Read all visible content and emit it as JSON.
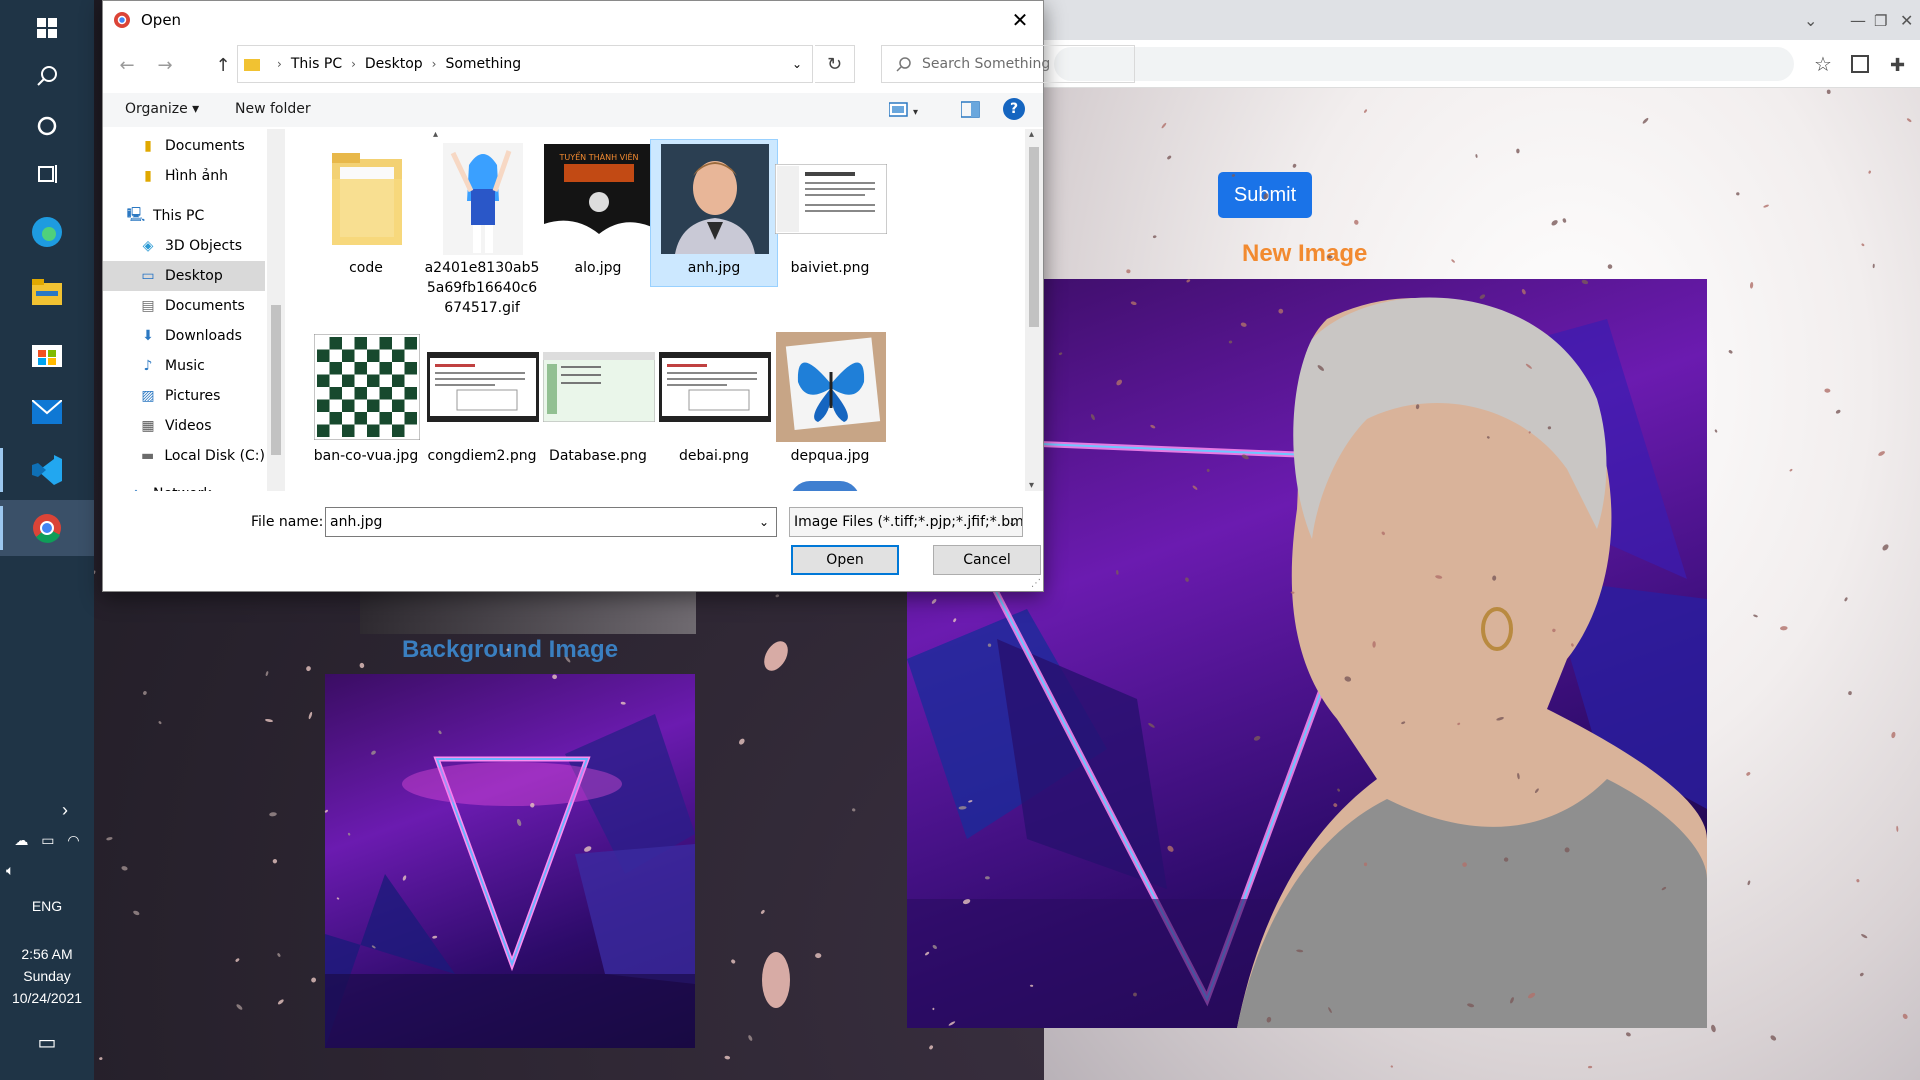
{
  "dialog": {
    "title": "Open",
    "close_glyph": "✕",
    "nav": {
      "back_glyph": "←",
      "forward_glyph": "→",
      "up_glyph": "↑"
    },
    "breadcrumb": [
      "This PC",
      "Desktop",
      "Something"
    ],
    "refresh_glyph": "↻",
    "search_placeholder": "Search Something",
    "toolbar": {
      "organize": "Organize ▾",
      "new_folder": "New folder",
      "help_glyph": "?"
    },
    "nav_pane": [
      {
        "label": "Documents",
        "icon": "folder-icon",
        "glyph": "▮"
      },
      {
        "label": "Hình ảnh",
        "icon": "folder-icon",
        "glyph": "▮"
      },
      {
        "label": "This PC",
        "icon": "pc-icon",
        "glyph": "🖳"
      },
      {
        "label": "3D Objects",
        "icon": "cube-icon",
        "glyph": "◈"
      },
      {
        "label": "Desktop",
        "icon": "desktop-icon",
        "glyph": "▭"
      },
      {
        "label": "Documents",
        "icon": "document-icon",
        "glyph": "▤"
      },
      {
        "label": "Downloads",
        "icon": "download-icon",
        "glyph": "⬇"
      },
      {
        "label": "Music",
        "icon": "music-icon",
        "glyph": "♪"
      },
      {
        "label": "Pictures",
        "icon": "pictures-icon",
        "glyph": "▨"
      },
      {
        "label": "Videos",
        "icon": "video-icon",
        "glyph": "▦"
      },
      {
        "label": "Local Disk (C:)",
        "icon": "disk-icon",
        "glyph": "▬"
      },
      {
        "label": "Network",
        "icon": "network-icon",
        "glyph": "⌂"
      }
    ],
    "files": [
      {
        "name": "code",
        "kind": "folder"
      },
      {
        "name": "a2401e8130ab55a69fb16640c6674517.gif",
        "kind": "anime"
      },
      {
        "name": "alo.jpg",
        "kind": "poster"
      },
      {
        "name": "anh.jpg",
        "kind": "portrait",
        "selected": true
      },
      {
        "name": "baiviet.png",
        "kind": "doc"
      },
      {
        "name": "ban-co-vua.jpg",
        "kind": "chess"
      },
      {
        "name": "congdiem2.png",
        "kind": "screen"
      },
      {
        "name": "Database.png",
        "kind": "sheet"
      },
      {
        "name": "debai.png",
        "kind": "screen"
      },
      {
        "name": "depqua.jpg",
        "kind": "butterfly"
      }
    ],
    "file_name_label": "File name:",
    "file_name_value": "anh.jpg",
    "file_type": "Image Files (*.tiff;*.pjp;*.jfif;*.bm",
    "open_label": "Open",
    "cancel_label": "Cancel"
  },
  "page": {
    "submit_label": "Submit",
    "new_image_title": "New Image",
    "background_image_title": "Background Image"
  },
  "taskbar": {
    "language": "ENG",
    "time": "2:56 AM",
    "day": "Sunday",
    "date": "10/24/2021"
  },
  "colors": {
    "accent": "#1a73e8",
    "new_image_title": "#f28a30",
    "bg_image_title": "#3a7fc0",
    "taskbar": "#1f3446",
    "selection": "#cce8ff"
  }
}
